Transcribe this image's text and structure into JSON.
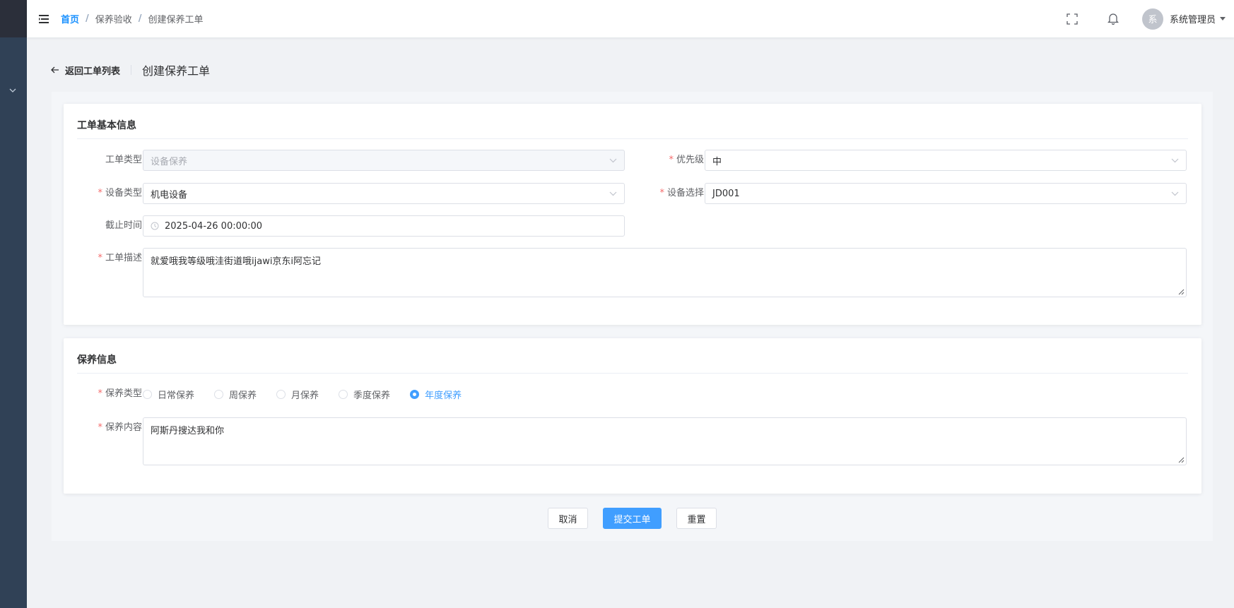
{
  "sidebar": {
    "toggle_icon": "chevron-down-icon"
  },
  "header": {
    "breadcrumb": [
      "首页",
      "保养验收",
      "创建保养工单"
    ],
    "user": {
      "avatar_text": "系",
      "name": "系统管理员"
    }
  },
  "page": {
    "back_label": "返回工单列表",
    "title": "创建保养工单"
  },
  "basic": {
    "title": "工单基本信息",
    "order_type": {
      "label": "工单类型",
      "value": "设备保养"
    },
    "priority": {
      "label": "优先级",
      "value": "中"
    },
    "device_type": {
      "label": "设备类型",
      "value": "机电设备"
    },
    "device_select": {
      "label": "设备选择",
      "value": "JD001"
    },
    "deadline": {
      "label": "截止时间",
      "value": "2025-04-26 00:00:00"
    },
    "description": {
      "label": "工单描述",
      "value": "就爱哦我等级哦洼街道哦ijawi京东i阿忘记"
    }
  },
  "maintenance": {
    "title": "保养信息",
    "type_label": "保养类型",
    "options": [
      "日常保养",
      "周保养",
      "月保养",
      "季度保养",
      "年度保养"
    ],
    "selected": "年度保养",
    "content": {
      "label": "保养内容",
      "value": "阿斯丹搜达我和你"
    }
  },
  "actions": {
    "cancel": "取消",
    "submit": "提交工单",
    "reset": "重置"
  },
  "colors": {
    "primary": "#409eff",
    "sidebar": "#304156",
    "required": "#f56c6c"
  }
}
